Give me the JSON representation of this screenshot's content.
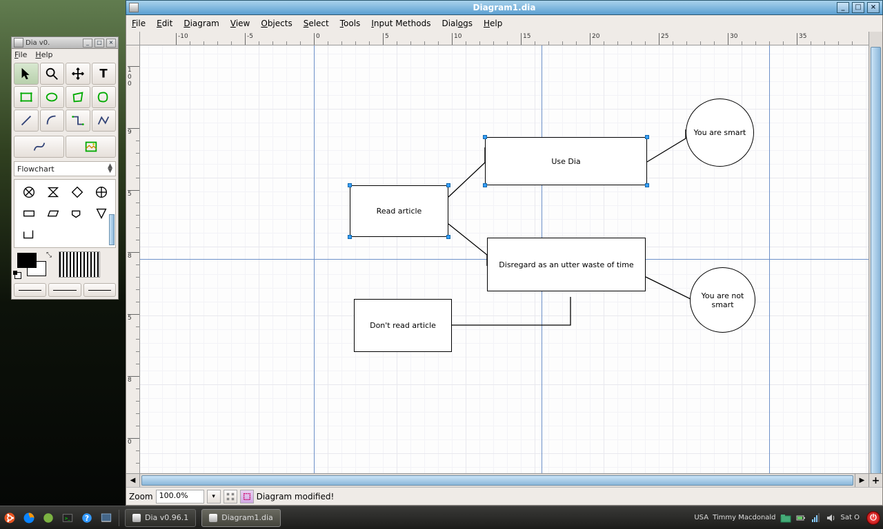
{
  "toolbox": {
    "title": "Dia v0.",
    "menu": {
      "file": "File",
      "help": "Help"
    },
    "sheet_selected": "Flowchart"
  },
  "diagram": {
    "title": "Diagram1.dia",
    "menu": {
      "file": "File",
      "edit": "Edit",
      "diagram": "Diagram",
      "view": "View",
      "objects": "Objects",
      "select": "Select",
      "tools": "Tools",
      "input_methods": "Input Methods",
      "dialogs": "Dialogs",
      "help": "Help"
    },
    "ruler_h": [
      "-10",
      "-5",
      "0",
      "5",
      "10",
      "15",
      "20",
      "25",
      "30",
      "35"
    ],
    "ruler_v_top": "10",
    "ruler_v_labels": [
      "9",
      "5",
      "8",
      "5",
      "8",
      "0"
    ],
    "shapes": {
      "read": "Read article",
      "use": "Use Dia",
      "disregard": "Disregard as an utter waste of time",
      "dontread": "Don't read article",
      "smart": "You are smart",
      "notsmart": "You are not smart"
    },
    "zoom_label": "Zoom",
    "zoom_value": "100.0%",
    "status": "Diagram modified!"
  },
  "taskbar": {
    "task1": "Dia v0.96.1",
    "task2": "Diagram1.dia",
    "user_loc": "USA",
    "user_name": "Timmy Macdonald",
    "clock": "Sat O"
  }
}
